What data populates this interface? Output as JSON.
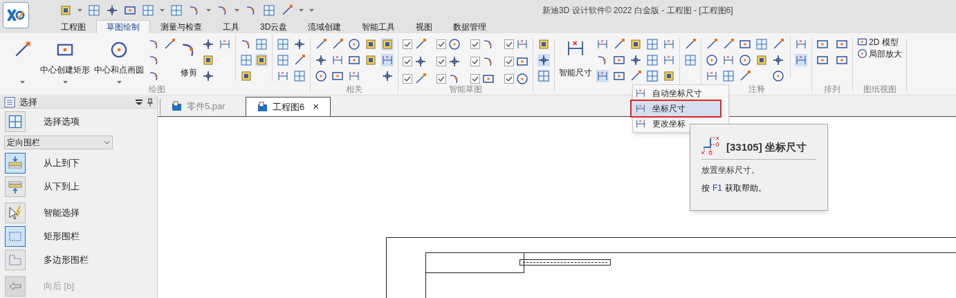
{
  "window": {
    "title": "新迪3D 设计软件© 2022 白金版 - 工程图 - [工程图6]"
  },
  "ribbon_tabs": [
    {
      "label": "工程图",
      "selected": false
    },
    {
      "label": "草图绘制",
      "selected": true
    },
    {
      "label": "测量与检查",
      "selected": false
    },
    {
      "label": "工具",
      "selected": false
    },
    {
      "label": "3D云盘",
      "selected": false
    },
    {
      "label": "流域创建",
      "selected": false
    },
    {
      "label": "智能工具",
      "selected": false
    },
    {
      "label": "视图",
      "selected": false
    },
    {
      "label": "数据管理",
      "selected": false
    }
  ],
  "ribbon_groups": [
    {
      "kind": "draw",
      "label": "绘图",
      "large_buttons": [
        {
          "label": "中心创建矩形"
        },
        {
          "label": "中心和点画圆"
        },
        {
          "label": "修剪"
        }
      ]
    },
    {
      "kind": "relations",
      "label": "相关"
    },
    {
      "kind": "smart_sketch",
      "label": "智能草图",
      "options": [
        {
          "checked": true
        },
        {
          "checked": true
        },
        {
          "checked": true
        },
        {
          "checked": true
        },
        {
          "checked": true
        },
        {
          "checked": true
        },
        {
          "checked": true
        },
        {
          "checked": true
        },
        {
          "checked": true
        },
        {
          "checked": true
        },
        {
          "checked": true
        },
        {
          "checked": true
        }
      ]
    },
    {
      "kind": "bulb"
    },
    {
      "kind": "dimension",
      "large_button": {
        "label": "智能尺寸"
      }
    },
    {
      "kind": "text_style"
    },
    {
      "kind": "annotation",
      "label": "注释"
    },
    {
      "kind": "arrange",
      "label": "排列"
    },
    {
      "kind": "sheet_views",
      "label": "图纸视图",
      "items": [
        {
          "label": "2D 模型"
        },
        {
          "label": "局部放大"
        }
      ]
    }
  ],
  "select_panel": {
    "title": "选择",
    "options_button": {
      "label": "选择选项"
    },
    "fence_dropdown": {
      "value": "定向围栏"
    },
    "items": [
      {
        "label": "从上到下",
        "selected": true,
        "disabled": false
      },
      {
        "label": "从下到上",
        "selected": false,
        "disabled": false
      },
      {
        "label": "智能选择",
        "selected": false,
        "disabled": false
      },
      {
        "label": "矩形围栏",
        "selected": true,
        "disabled": false
      },
      {
        "label": "多边形围栏",
        "selected": false,
        "disabled": false
      },
      {
        "label": "向后 [b]",
        "selected": false,
        "disabled": true
      }
    ]
  },
  "document_tabs": [
    {
      "label": "零件5.par",
      "selected": false
    },
    {
      "label": "工程图6",
      "selected": true,
      "close": "×"
    }
  ],
  "dimension_menu": [
    {
      "label": "自动坐标尺寸",
      "selected": false
    },
    {
      "label": "坐标尺寸",
      "selected": true
    },
    {
      "label": "更改坐标",
      "selected": false
    }
  ],
  "tooltip": {
    "title": "[33105] 坐标尺寸",
    "description": "放置坐标尺寸。",
    "help_prefix": "按",
    "help_key": "F1",
    "help_suffix": "获取帮助。"
  }
}
